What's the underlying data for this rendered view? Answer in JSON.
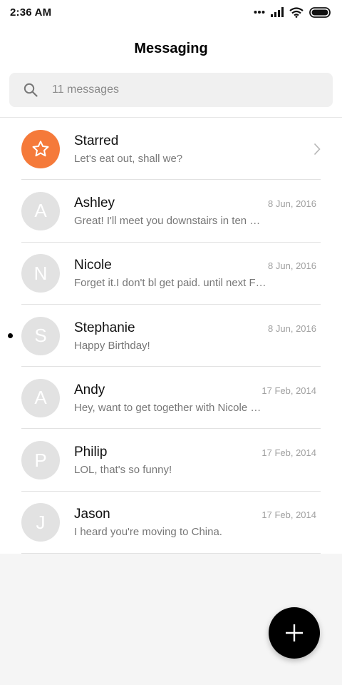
{
  "status_bar": {
    "time": "2:36 AM",
    "icons": [
      "dots-icon",
      "signal-icon",
      "wifi-icon",
      "battery-icon"
    ]
  },
  "header": {
    "title": "Messaging"
  },
  "search": {
    "placeholder": "11 messages",
    "value": ""
  },
  "starred": {
    "name": "Starred",
    "preview": "Let's eat out, shall we?",
    "icon": "star-icon",
    "color": "#f57a3a"
  },
  "conversations": [
    {
      "initial": "A",
      "name": "Ashley",
      "date": "8 Jun, 2016",
      "preview": "Great! I'll meet you downstairs in ten …",
      "unread": false
    },
    {
      "initial": "N",
      "name": "Nicole",
      "date": "8 Jun, 2016",
      "preview": "Forget it.I don't bl get paid. until next F…",
      "unread": false
    },
    {
      "initial": "S",
      "name": "Stephanie",
      "date": "8 Jun, 2016",
      "preview": "Happy Birthday!",
      "unread": true
    },
    {
      "initial": "A",
      "name": "Andy",
      "date": "17 Feb, 2014",
      "preview": "Hey, want to get together with Nicole …",
      "unread": false
    },
    {
      "initial": "P",
      "name": "Philip",
      "date": "17 Feb, 2014",
      "preview": "LOL, that's so funny!",
      "unread": false
    },
    {
      "initial": "J",
      "name": "Jason",
      "date": "17 Feb, 2014",
      "preview": "I heard you're moving to China.",
      "unread": false
    }
  ],
  "fab": {
    "icon": "plus-icon"
  },
  "colors": {
    "accent": "#f57a3a",
    "avatar": "#e2e2e2",
    "fab": "#000000"
  }
}
